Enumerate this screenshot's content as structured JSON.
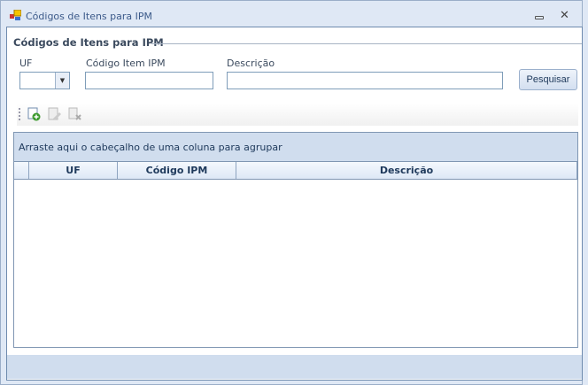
{
  "window": {
    "title": "Códigos de Itens para IPM"
  },
  "group": {
    "title": "Códigos de Itens para IPM"
  },
  "filters": {
    "uf_label": "UF",
    "uf_value": "",
    "codigo_label": "Código Item IPM",
    "codigo_value": "",
    "descricao_label": "Descrição",
    "descricao_value": "",
    "search_label": "Pesquisar"
  },
  "toolbar": {
    "items": [
      "add-icon",
      "edit-icon",
      "delete-icon"
    ]
  },
  "grid": {
    "group_panel_text": "Arraste aqui o cabeçalho de uma coluna para agrupar",
    "columns": [
      "UF",
      "Código IPM",
      "Descrição"
    ],
    "rows": []
  }
}
